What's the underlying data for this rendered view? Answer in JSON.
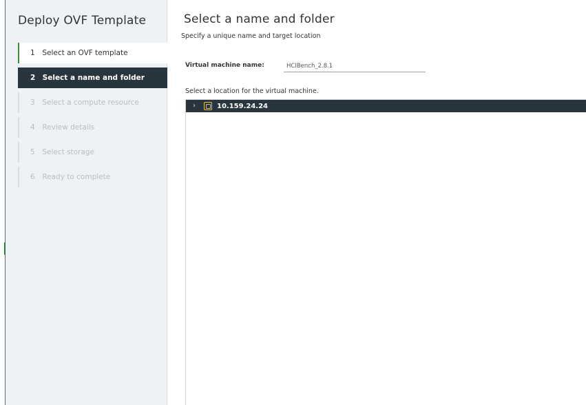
{
  "sidebar": {
    "title": "Deploy OVF Template",
    "steps": [
      {
        "number": "1",
        "label": "Select an OVF template",
        "state": "done"
      },
      {
        "number": "2",
        "label": "Select a name and folder",
        "state": "active"
      },
      {
        "number": "3",
        "label": "Select a compute resource",
        "state": "disabled"
      },
      {
        "number": "4",
        "label": "Review details",
        "state": "disabled"
      },
      {
        "number": "5",
        "label": "Select storage",
        "state": "disabled"
      },
      {
        "number": "6",
        "label": "Ready to complete",
        "state": "disabled"
      }
    ]
  },
  "main": {
    "title": "Select a name and folder",
    "subtitle": "Specify a unique name and target location",
    "vm_name_label": "Virtual machine name:",
    "vm_name_value": "HCIBench_2.8.1",
    "location_label": "Select a location for the virtual machine.",
    "tree": [
      {
        "label": "10.159.24.24",
        "icon": "datacenter-icon",
        "expand_icon": "chevron-right-icon",
        "selected": true
      }
    ]
  },
  "colors": {
    "sidebar_bg": "#eef2f5",
    "active_step_bg": "#29353d",
    "done_step_accent": "#3a8f3a",
    "disabled_text": "#b8bdc2",
    "tree_selected_bg": "#29353d",
    "datacenter_icon": "#e0c341"
  }
}
